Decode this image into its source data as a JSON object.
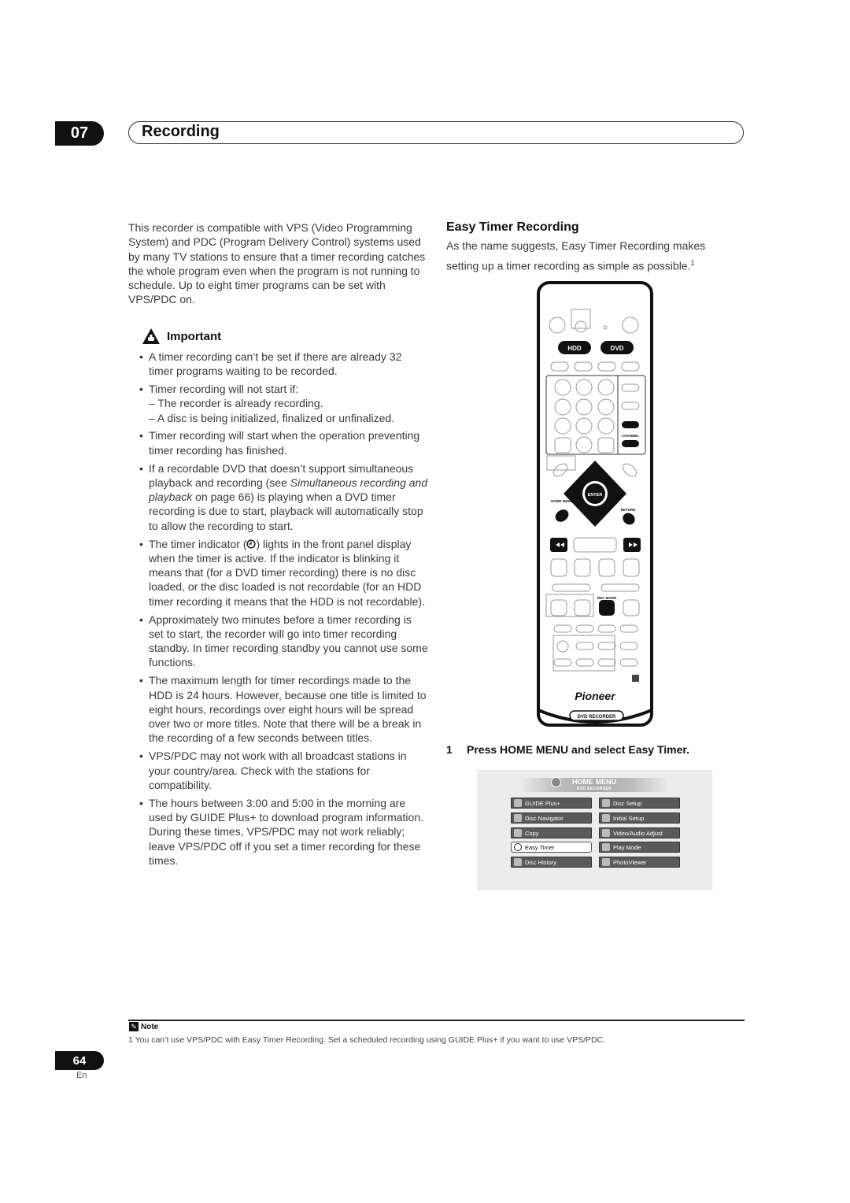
{
  "header": {
    "chapter_number": "07",
    "chapter_title": "Recording"
  },
  "intro": "This recorder is compatible with VPS (Video Programming System) and PDC (Program Delivery Control) systems used by many TV stations to ensure that a timer recording catches the whole program even when the program is not running to schedule. Up to eight timer programs can be set with VPS/PDC on.",
  "important": {
    "label": "Important",
    "icon": "warning-hand-icon",
    "bullets": [
      {
        "text": "A timer recording can’t be set if there are already 32 timer programs waiting to be recorded."
      },
      {
        "text": "Timer recording will not start if:",
        "sub": [
          "– The recorder is already recording.",
          "– A disc is being initialized, finalized or unfinalized."
        ]
      },
      {
        "text": "Timer recording will start when the operation preventing timer recording has finished."
      },
      {
        "pre": "If a recordable DVD that doesn’t support simultaneous playback and recording (see ",
        "link": "Simultaneous recording and playback",
        "post": " on page 66) is playing when a DVD timer recording is due to start, playback will automatically stop to allow the recording to start."
      },
      {
        "pre": "The timer indicator (",
        "icon": "timer-icon",
        "post": ") lights in the front panel display when the timer is active. If the indicator is blinking it means that (for a DVD timer recording) there is no disc loaded, or the disc loaded is not recordable (for an HDD timer recording it means that the HDD is not recordable)."
      },
      {
        "text": "Approximately two minutes before a timer recording is set to start, the recorder will go into timer recording standby. In timer recording standby you cannot use some functions."
      },
      {
        "text": "The maximum length for timer recordings made to the HDD is 24 hours. However, because one title is limited to eight hours, recordings over eight hours will be spread over two or more titles. Note that there will be a break in the recording of a few seconds between titles."
      },
      {
        "text": "VPS/PDC may not work with all broadcast stations in your country/area. Check with the stations for compatibility."
      },
      {
        "text": "The hours between 3:00 and 5:00 in the morning are used by GUIDE Plus+ to download program information. During these times, VPS/PDC may not work reliably; leave VPS/PDC off if you set a timer recording for these times."
      }
    ]
  },
  "easy_timer": {
    "heading": "Easy Timer Recording",
    "description": "As the name suggests, Easy Timer Recording makes setting up a timer recording as simple as possible.",
    "footnote_ref": "1"
  },
  "remote": {
    "hdd_label": "HDD",
    "dvd_label": "DVD",
    "channel_label": "CHANNEL",
    "enter_label": "ENTER",
    "home_menu_label": "HOME MENU",
    "return_label": "RETURN",
    "rec_mode_label": "REC MODE",
    "brand": "Pioneer",
    "model_label": "DVD RECORDER"
  },
  "step": {
    "number": "1",
    "text": "Press HOME MENU and select Easy Timer."
  },
  "home_menu": {
    "title": "HOME MENU",
    "subtitle": "DVD RECORDER",
    "left_items": [
      "GUIDE Plus+",
      "Disc Navigator",
      "Copy",
      "Easy Timer",
      "Disc History"
    ],
    "right_items": [
      "Disc Setup",
      "Initial Setup",
      "Video/Audio Adjust",
      "Play Mode",
      "PhotoViewer"
    ],
    "selected": "Easy Timer"
  },
  "footer": {
    "note_label": "Note",
    "note_text": "1 You can’t use VPS/PDC with Easy Timer Recording. Set a scheduled recording using GUIDE Plus+ if you want to use VPS/PDC.",
    "page_number": "64",
    "language": "En"
  }
}
